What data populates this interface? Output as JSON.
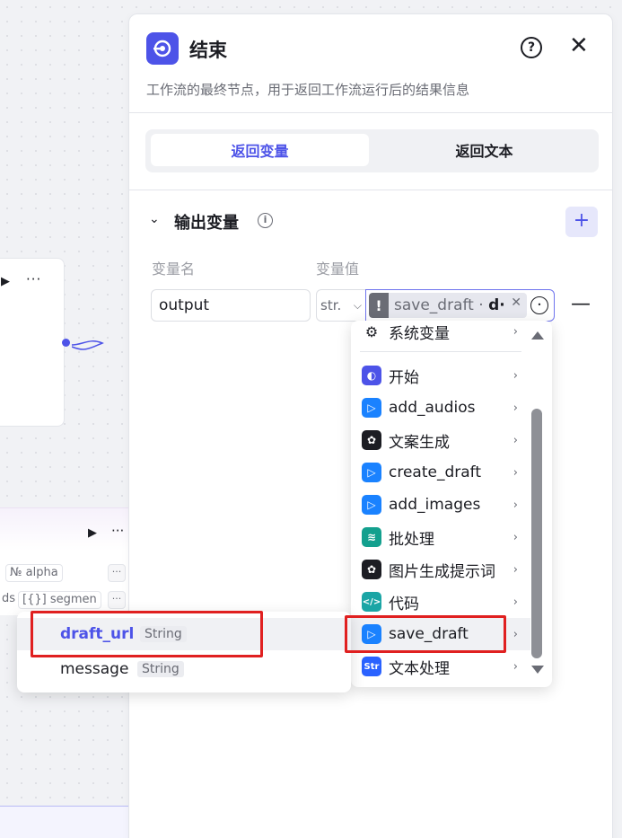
{
  "panel": {
    "title": "结束",
    "description": "工作流的最终节点，用于返回工作流运行后的结果信息",
    "tabs": [
      {
        "label": "返回变量",
        "active": true
      },
      {
        "label": "返回文本",
        "active": false
      }
    ]
  },
  "output_section": {
    "title": "输出变量",
    "col_name": "变量名",
    "col_value": "变量值",
    "row": {
      "name": "output",
      "type": "str.",
      "ref_node": "save_draft",
      "ref_sep": " · ",
      "ref_var": "d·"
    }
  },
  "node_menu": {
    "items": [
      {
        "label": "系统变量",
        "icon": "settings-icon",
        "color": "#1c1d23"
      },
      {
        "label": "开始",
        "icon": "start-node-icon",
        "color": "#4d53e8"
      },
      {
        "label": "add_audios",
        "icon": "plugin-icon",
        "color": "#1a82ff"
      },
      {
        "label": "文案生成",
        "icon": "llm-icon",
        "color": "#1c1d23"
      },
      {
        "label": "create_draft",
        "icon": "plugin-icon",
        "color": "#1a82ff"
      },
      {
        "label": "add_images",
        "icon": "plugin-icon",
        "color": "#1a82ff"
      },
      {
        "label": "批处理",
        "icon": "batch-icon",
        "color": "#13a08e"
      },
      {
        "label": "图片生成提示词",
        "icon": "llm-icon",
        "color": "#1c1d23"
      },
      {
        "label": "代码",
        "icon": "code-icon",
        "color": "#1ba5a5"
      },
      {
        "label": "save_draft",
        "icon": "plugin-icon",
        "color": "#1a82ff"
      },
      {
        "label": "文本处理",
        "icon": "text-process-icon",
        "color": "#2a62ff"
      }
    ]
  },
  "sub_menu": {
    "items": [
      {
        "name": "draft_url",
        "type": "String"
      },
      {
        "name": "message",
        "type": "String"
      }
    ]
  },
  "canvas": {
    "param_alpha": "alpha",
    "param_segment": "segmen",
    "param_ds": "ds"
  },
  "colors": {
    "accent": "#4d53e8",
    "highlight": "#e02020"
  }
}
